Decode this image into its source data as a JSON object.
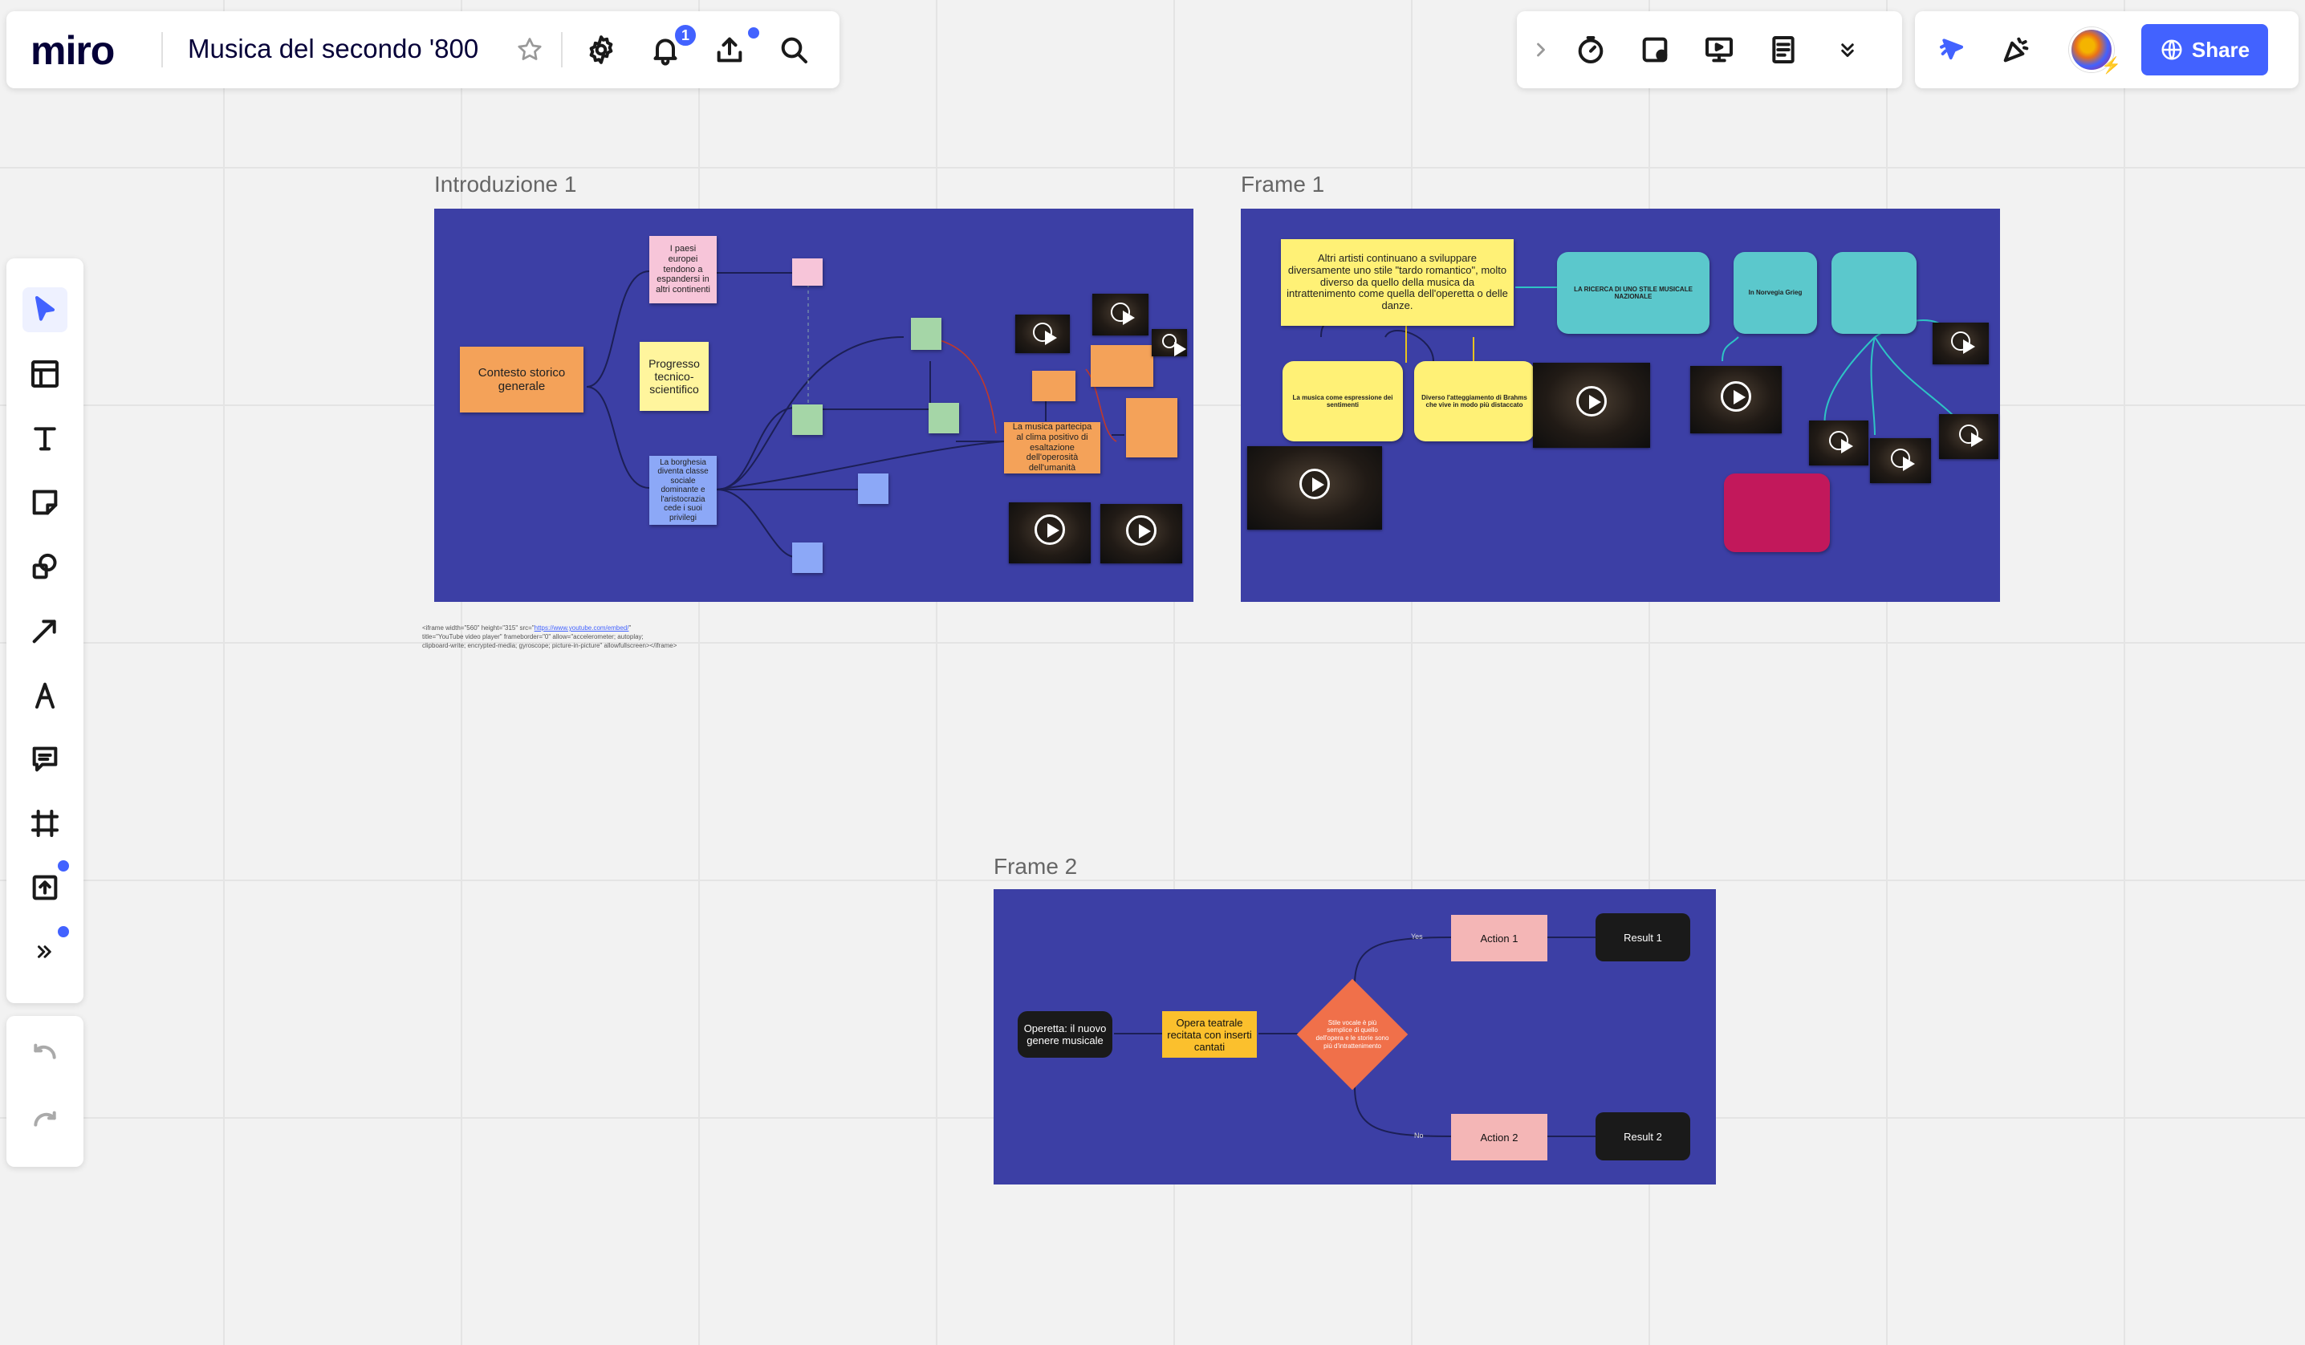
{
  "topbar": {
    "logo": "miro",
    "board_title": "Musica del secondo '800",
    "notifications_count": "1"
  },
  "right_toolbar": {
    "share_label": "Share"
  },
  "colors": {
    "accent": "#4262ff",
    "frame_bg": "#3c3fa5",
    "canvas_bg": "#f2f2f2"
  },
  "left_toolbar": {
    "tools": [
      "select-icon",
      "templates-icon",
      "text-icon",
      "sticky-note-icon",
      "shapes-icon",
      "connection-line-icon",
      "pen-icon",
      "comment-icon",
      "frame-icon",
      "upload-icon",
      "more-tools-icon"
    ],
    "undo": "undo-icon",
    "redo": "redo-icon"
  },
  "frames": {
    "intro": {
      "label": "Introduzione 1",
      "contesto": "Contesto storico generale",
      "paesi": "I paesi europei tendono a espandersi in altri continenti",
      "progresso": "Progresso tecnico-scientifico",
      "borghesia": "La borghesia diventa classe sociale dominante e l'aristocrazia cede i suoi privilegi",
      "musica_clima": "La musica partecipa al clima positivo di esaltazione dell'operosità dell'umanità"
    },
    "frame1": {
      "label": "Frame 1",
      "main_note": "Altri artisti continuano a sviluppare diversamente uno stile \"tardo romantico\", molto diverso da quello della musica da intrattenimento come quella dell'operetta o delle danze.",
      "ricerca": "LA RICERCA DI UNO STILE MUSICALE NAZIONALE",
      "grieg": "In Norvegia Grieg",
      "brahms": "Diverso l'atteggiamento di Brahms che vive in modo più distaccato",
      "musica_espressione": "La musica come espressione dei sentimenti"
    },
    "frame2": {
      "label": "Frame 2",
      "start": "Operetta: il nuovo genere musicale",
      "opera": "Opera teatrale recitata con inserti cantati",
      "decision": "Stile vocale è più semplice di quello dell'opera e le storie sono più d'intrattenimento",
      "yes": "Yes",
      "no": "No",
      "action1": "Action 1",
      "action2": "Action 2",
      "result1": "Result 1",
      "result2": "Result 2"
    }
  },
  "embed_code": {
    "line1_prefix": "<iframe width=\"560\" height=\"315\" src=\"",
    "link": "https://www.youtube.com/embed/",
    "line1_suffix": "\"",
    "line2": "title=\"YouTube video player\" frameborder=\"0\" allow=\"accelerometer; autoplay;",
    "line3": "clipboard-write; encrypted-media; gyroscope; picture-in-picture\" allowfullscreen></iframe>"
  }
}
